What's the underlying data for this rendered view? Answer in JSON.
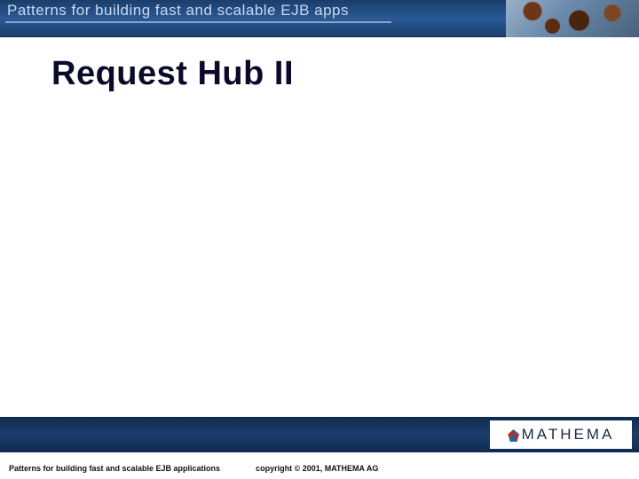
{
  "header": {
    "title": "Patterns for building fast and scalable EJB apps"
  },
  "main": {
    "title": "Request Hub II"
  },
  "logo": {
    "text": "MATHEMA"
  },
  "footer": {
    "left": "Patterns for building fast and scalable EJB applications",
    "right": "copyright © 2001, MATHEMA AG"
  }
}
